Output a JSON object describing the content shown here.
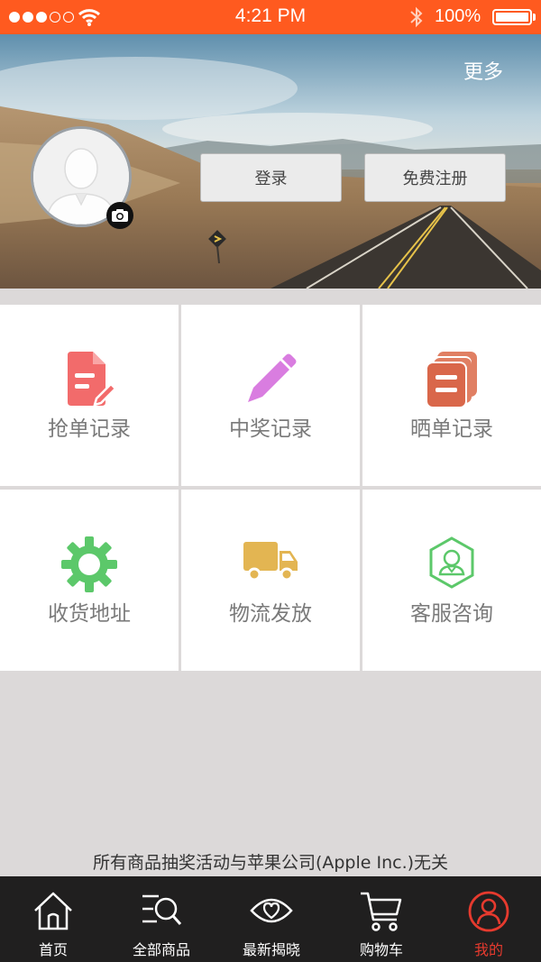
{
  "status_bar": {
    "time": "4:21 PM",
    "battery": "100%",
    "signal_bars_filled": 3,
    "signal_bars_total": 5
  },
  "header": {
    "more_link": "更多",
    "login_button": "登录",
    "register_button": "免费注册"
  },
  "grid": {
    "items": [
      {
        "label": "抢单记录",
        "icon": "document-edit-icon",
        "color": "#f26b6b"
      },
      {
        "label": "中奖记录",
        "icon": "pencil-icon",
        "color": "#d97de0"
      },
      {
        "label": "晒单记录",
        "icon": "stacked-cards-icon",
        "color": "#d9674a"
      },
      {
        "label": "收货地址",
        "icon": "gear-icon",
        "color": "#5cc86a"
      },
      {
        "label": "物流发放",
        "icon": "truck-icon",
        "color": "#e3b552"
      },
      {
        "label": "客服咨询",
        "icon": "customer-service-icon",
        "color": "#5cc86a"
      }
    ]
  },
  "disclaimer": "所有商品抽奖活动与苹果公司(Apple  Inc.)无关",
  "tab_bar": {
    "tabs": [
      {
        "label": "首页",
        "icon": "home-icon"
      },
      {
        "label": "全部商品",
        "icon": "search-list-icon"
      },
      {
        "label": "最新揭晓",
        "icon": "eye-icon"
      },
      {
        "label": "购物车",
        "icon": "cart-icon"
      },
      {
        "label": "我的",
        "icon": "user-icon",
        "active": true
      }
    ],
    "active_color": "#e63a2e"
  },
  "colors": {
    "status_bar": "#ff5a1f",
    "tab_bar": "#201f1f",
    "page_background": "#dcd9d9"
  }
}
